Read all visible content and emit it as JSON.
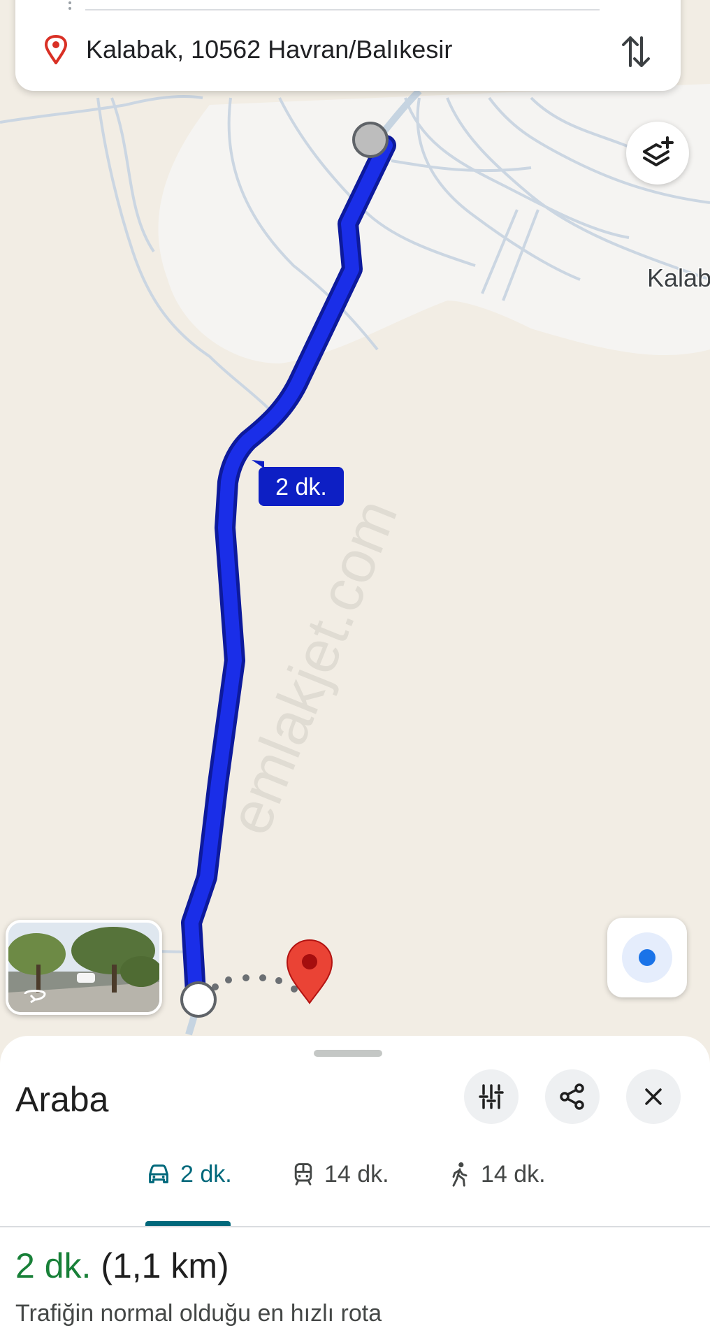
{
  "destination": {
    "text": "Kalabak, 10562 Havran/Balıkesir"
  },
  "map": {
    "place_label": "Kalabak",
    "route_time_bubble": "2 dk.",
    "watermark": "emlakjet.com"
  },
  "sheet": {
    "mode_title": "Araba",
    "tabs": [
      {
        "icon": "car-icon",
        "label": "2 dk.",
        "active": true
      },
      {
        "icon": "train-icon",
        "label": "14 dk.",
        "active": false
      },
      {
        "icon": "walk-icon",
        "label": "14 dk.",
        "active": false
      }
    ],
    "summary_duration": "2 dk.",
    "summary_distance": "(1,1 km)",
    "route_description": "Trafiğin normal olduğu en hızlı rota"
  },
  "colors": {
    "route": "#1a2ee8",
    "accent_teal": "#00687b",
    "duration_green": "#188038",
    "marker_red": "#ea4335",
    "map_background": "#f2ede4"
  }
}
